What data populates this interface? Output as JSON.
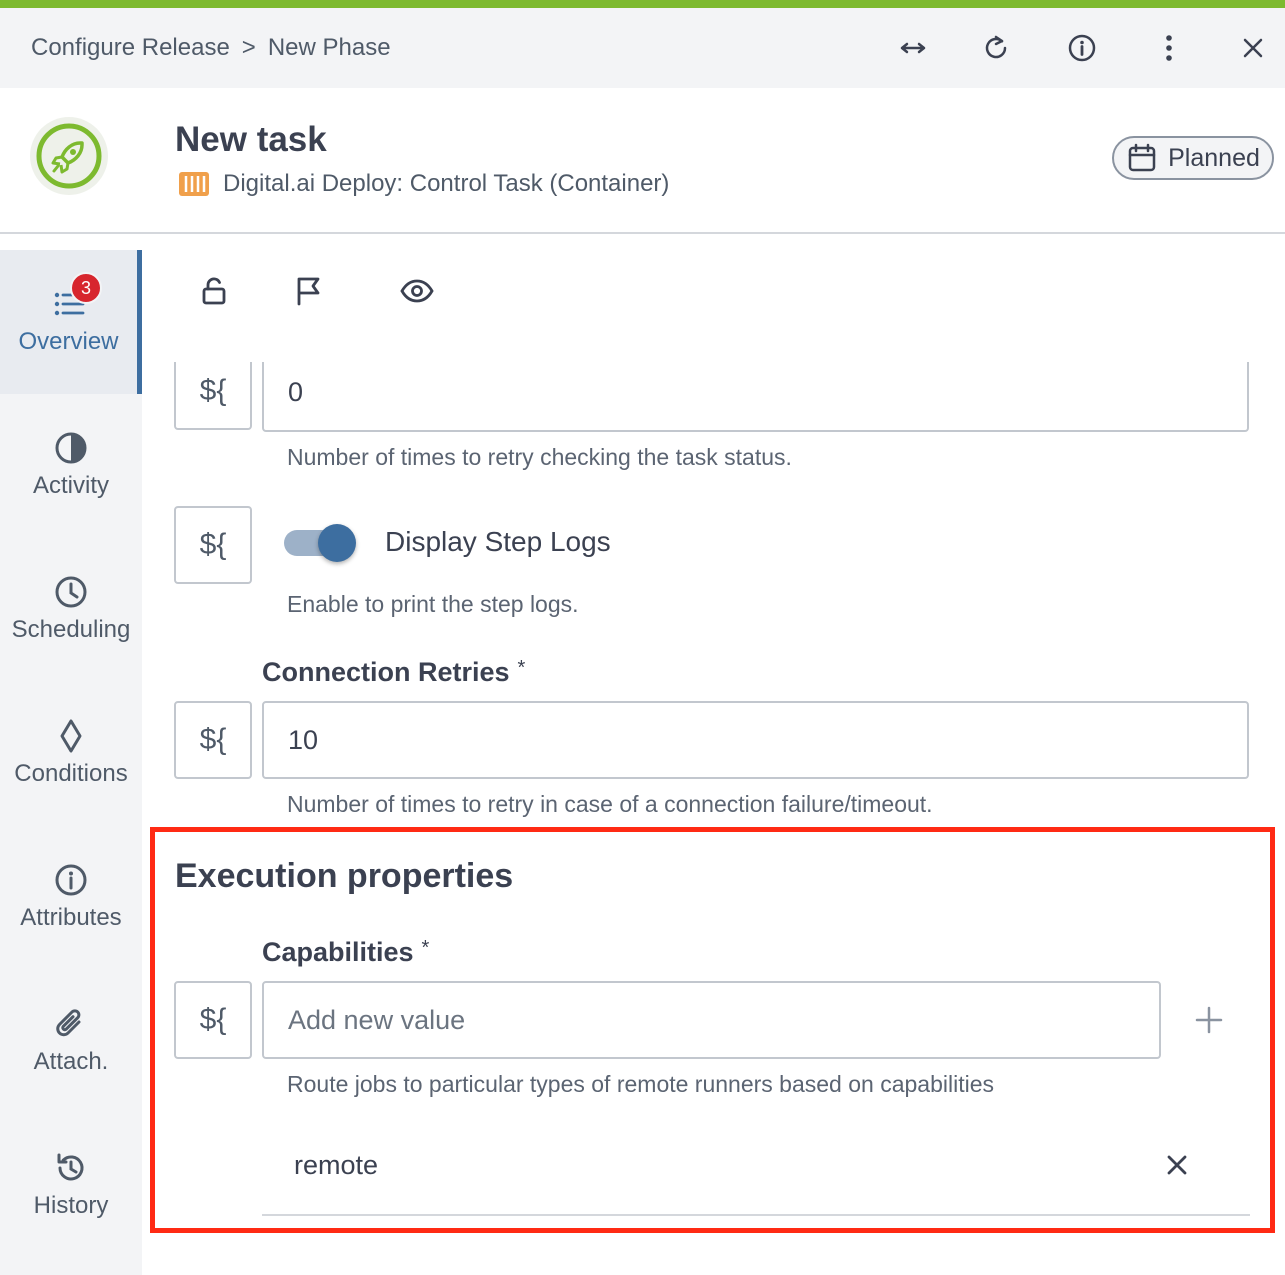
{
  "header": {
    "breadcrumb": [
      "Configure Release",
      "New Phase"
    ],
    "breadcrumb_separator": ">",
    "icons": [
      "expand-horizontal-icon",
      "refresh-icon",
      "info-icon",
      "more-vertical-icon",
      "close-icon"
    ],
    "accent_color": "#7dba2f"
  },
  "task": {
    "title": "New task",
    "type_label": "Digital.ai Deploy: Control Task (Container)",
    "status": "Planned"
  },
  "sidebar": {
    "items": [
      {
        "label": "Overview",
        "icon": "list-icon",
        "badge": "3",
        "active": true
      },
      {
        "label": "Activity",
        "icon": "pie-icon"
      },
      {
        "label": "Scheduling",
        "icon": "clock-icon"
      },
      {
        "label": "Conditions",
        "icon": "diamond-icon"
      },
      {
        "label": "Attributes",
        "icon": "info-icon"
      },
      {
        "label": "Attach.",
        "icon": "paperclip-icon"
      },
      {
        "label": "History",
        "icon": "history-icon"
      }
    ]
  },
  "toolbar": {
    "icons": [
      "unlock-icon",
      "flag-icon",
      "eye-icon"
    ]
  },
  "form": {
    "variable_button": "${",
    "retries_value": "0",
    "retries_help": "Number of times to retry checking the task status.",
    "display_logs_label": "Display Step Logs",
    "display_logs_on": true,
    "display_logs_help": "Enable to print the step logs.",
    "connection_retries_label": "Connection Retries",
    "required_mark": "*",
    "connection_retries_value": "10",
    "connection_retries_help": "Number of times to retry in case of a connection failure/timeout.",
    "execution_title": "Execution properties",
    "capabilities_label": "Capabilities",
    "capabilities_placeholder": "Add new value",
    "capabilities_help": "Route jobs to particular types of remote runners based on capabilities",
    "capabilities_items": [
      "remote"
    ]
  }
}
